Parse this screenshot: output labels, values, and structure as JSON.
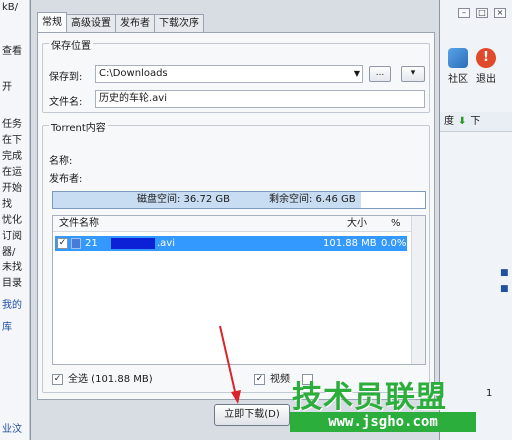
{
  "background": {
    "left_fragments": [
      "kB/",
      "查看",
      "开",
      "任务",
      "在下",
      "完成",
      "在运",
      "开始",
      "找",
      "忧化",
      "订阅",
      "器/",
      "未找",
      "目录",
      "我的",
      "库",
      "业汶"
    ],
    "toolbar": [
      {
        "label": "社区"
      },
      {
        "label": "退出"
      }
    ],
    "col_header": {
      "left": "度",
      "right": "下"
    },
    "row_num": "1"
  },
  "dialog": {
    "tabs": [
      "常规",
      "高级设置",
      "发布者",
      "下载次序"
    ],
    "save_group": {
      "title": "保存位置",
      "save_to_label": "保存到:",
      "save_path": "C:\\Downloads",
      "browse_label": "...",
      "menu_label": "▾",
      "filename_label": "文件名:",
      "filename": "历史的车轮.avi"
    },
    "torrent_group": {
      "title": "Torrent内容",
      "name_label": "名称:",
      "publisher_label": "发布者:",
      "disk_space": "磁盘空间: 36.72 GB",
      "free_space": "剩余空间: 6.46 GB",
      "columns": {
        "name": "文件名称",
        "size": "大小",
        "percent": "%"
      },
      "files": [
        {
          "name_start": "21",
          "name_end": ".avi",
          "size": "101.88 MB",
          "percent": "0.0%"
        }
      ],
      "select_all": "全选 (101.88 MB)",
      "video_label": "视频"
    },
    "download_button": "立即下载(D)"
  },
  "watermark": {
    "brand": "技术员联盟",
    "url": "www.jsgho.com"
  }
}
